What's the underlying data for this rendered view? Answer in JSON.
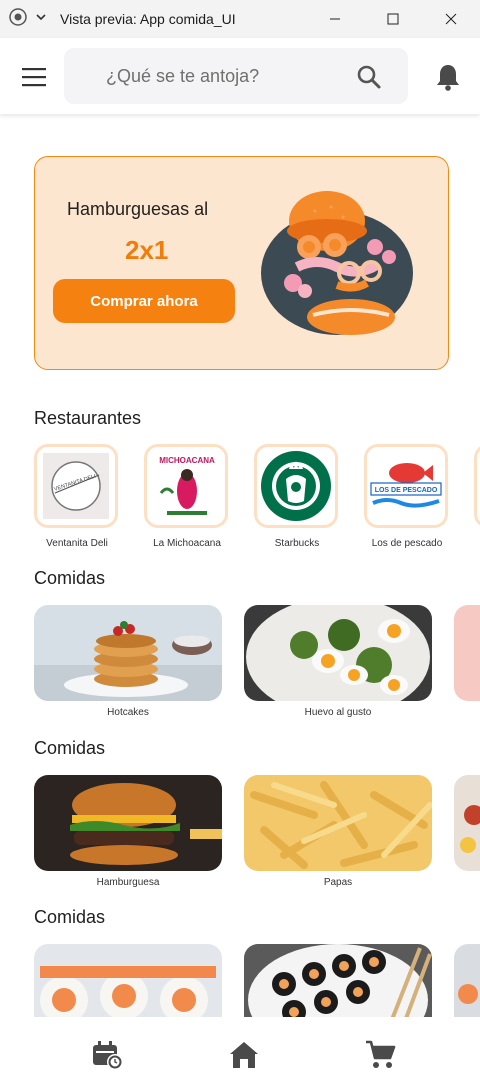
{
  "window": {
    "title": "Vista previa: App comida_UI"
  },
  "search": {
    "placeholder": "¿Qué se te antoja?"
  },
  "promo": {
    "title": "Hamburguesas al",
    "subtitle": "2x1",
    "button_label": "Comprar ahora"
  },
  "sections": {
    "restaurants": "Restaurantes",
    "foods1": "Comidas",
    "foods2": "Comidas",
    "foods3": "Comidas"
  },
  "restaurants": [
    {
      "name": "Ventanita Deli",
      "logo_text": "VENTANITA DELI"
    },
    {
      "name": "La Michoacana",
      "logo_text": "MICHOACANA"
    },
    {
      "name": "Starbucks",
      "logo_text": ""
    },
    {
      "name": "Los de pescado",
      "logo_text": "LOS DE PESCADO"
    }
  ],
  "foods_row1": [
    {
      "name": "Hotcakes"
    },
    {
      "name": "Huevo al gusto"
    }
  ],
  "foods_row2": [
    {
      "name": "Hamburguesa"
    },
    {
      "name": "Papas"
    }
  ],
  "foods_row3": [
    {
      "name": ""
    },
    {
      "name": ""
    }
  ],
  "colors": {
    "accent": "#f58110",
    "promo_bg": "#fde6cf",
    "starbucks_green": "#00704a"
  },
  "icons": {
    "menu": "hamburger-menu-icon",
    "search": "search-icon",
    "notifications": "bell-icon",
    "orders": "calendar-clock-icon",
    "home": "home-icon",
    "cart": "cart-icon"
  }
}
